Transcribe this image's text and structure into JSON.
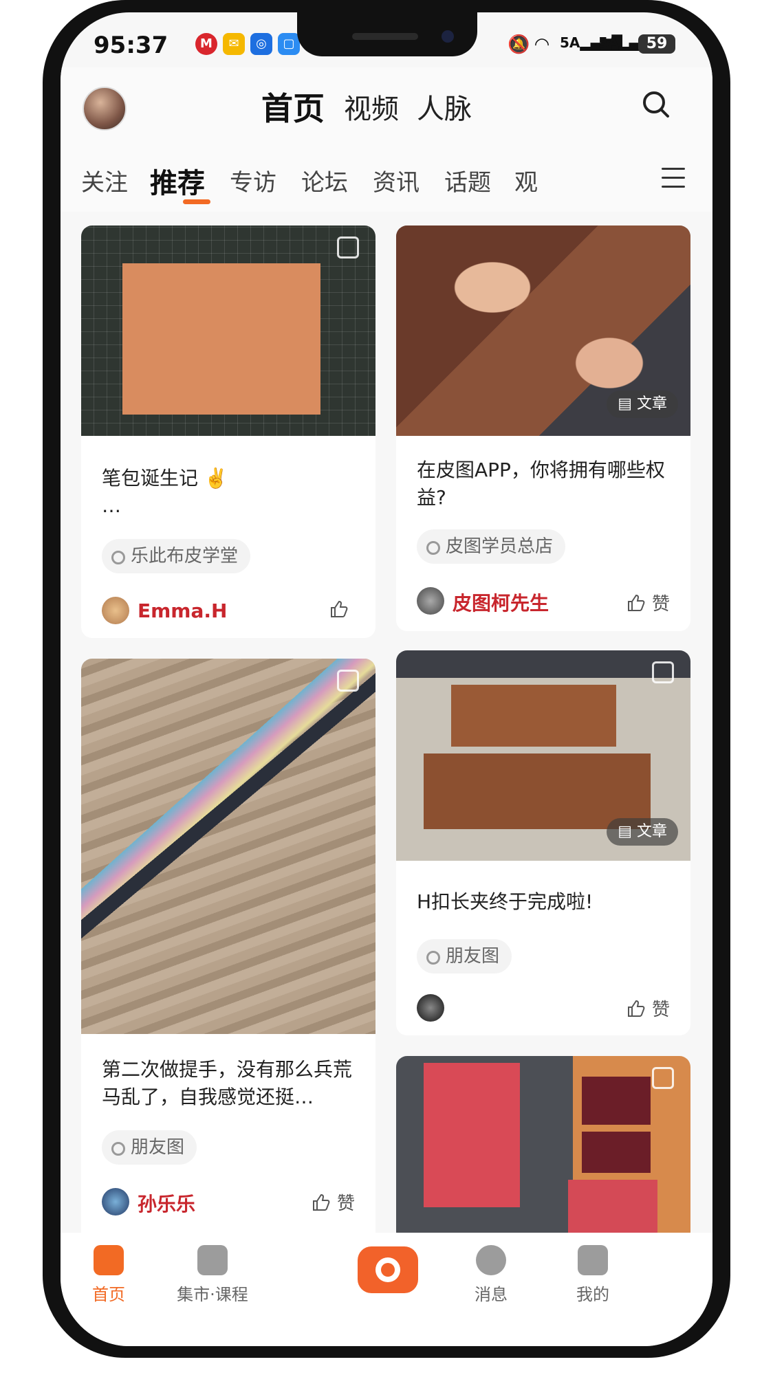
{
  "status_bar": {
    "time": "95:37",
    "network_1": "5A",
    "network_2": "5A",
    "battery": "59"
  },
  "header": {
    "nav": [
      "首页",
      "视频",
      "人脉"
    ]
  },
  "tabs": [
    "关注",
    "推荐",
    "专访",
    "论坛",
    "资讯",
    "话题",
    "观"
  ],
  "feed": [
    {
      "title": "笔包诞生记 ✌️",
      "title_extra": "…",
      "tag": "乐此布皮学堂",
      "author": "Emma.H",
      "like_label": "",
      "badge": ""
    },
    {
      "title": "在皮图APP，你将拥有哪些权益?",
      "tag": "皮图学员总店",
      "author": "皮图柯先生",
      "like_label": "赞",
      "badge": "文章"
    },
    {
      "title": "第二次做提手，没有那么兵荒马乱了，自我感觉还挺…",
      "tag": "朋友图",
      "author": "孙乐乐",
      "like_label": "赞",
      "badge": ""
    },
    {
      "title": "H扣长夹终于完成啦!",
      "tag": "朋友图",
      "author": "",
      "like_label": "赞",
      "badge": "文章"
    }
  ],
  "bottom_nav": {
    "home": "首页",
    "market": "集市·课程",
    "messages": "消息",
    "me": "我的"
  },
  "colors": {
    "accent": "#f26a24",
    "author_red": "#c8262d"
  }
}
